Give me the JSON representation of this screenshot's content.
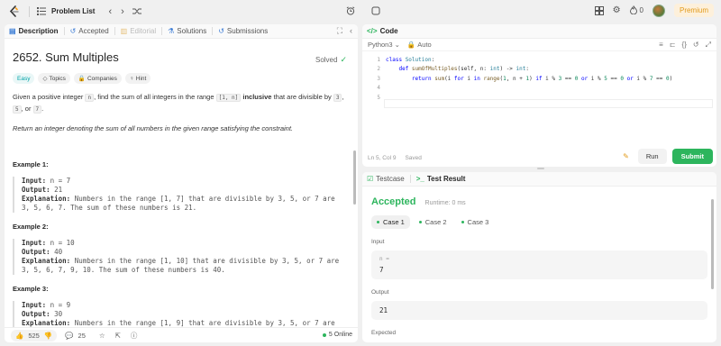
{
  "topbar": {
    "title": "Problem List",
    "streak_count": "0",
    "premium_label": "Premium"
  },
  "left_tabs": [
    {
      "label": "Description",
      "icon": "document-icon",
      "state": "active"
    },
    {
      "label": "Accepted",
      "icon": "history-icon",
      "state": "normal"
    },
    {
      "label": "Editorial",
      "icon": "book-icon",
      "state": "disabled"
    },
    {
      "label": "Solutions",
      "icon": "flask-icon",
      "state": "normal"
    },
    {
      "label": "Submissions",
      "icon": "history-icon",
      "state": "normal"
    }
  ],
  "problem": {
    "title": "2652. Sum Multiples",
    "status": "Solved",
    "tags": [
      "Easy",
      "Topics",
      "Companies",
      "Hint"
    ],
    "desc_1a": "Given a positive integer ",
    "desc_1_n": "n",
    "desc_1b": ", find the sum of all integers in the range ",
    "desc_1_range": "[1, n]",
    "desc_1_bold": "inclusive",
    "desc_1c": " that are divisible by ",
    "desc_1_3": "3",
    "desc_1d": ", ",
    "desc_1_5": "5",
    "desc_1e": ", or ",
    "desc_1_7": "7",
    "desc_1f": ".",
    "desc_2": "Return an integer denoting the sum of all numbers in the given range satisfying the constraint."
  },
  "examples": [
    {
      "title": "Example 1:",
      "input_label": "Input:",
      "input_value": " n = 7",
      "output_label": "Output:",
      "output_value": " 21",
      "explanation_label": "Explanation:",
      "explanation": " Numbers in the range [1, 7] that are divisible by 3, 5, or 7 are 3, 5, 6, 7. The sum of these numbers is 21."
    },
    {
      "title": "Example 2:",
      "input_label": "Input:",
      "input_value": " n = 10",
      "output_label": "Output:",
      "output_value": " 40",
      "explanation_label": "Explanation:",
      "explanation": " Numbers in the range [1, 10] that are divisible by 3, 5, or 7 are 3, 5, 6, 7, 9, 10. The sum of these numbers is 40."
    },
    {
      "title": "Example 3:",
      "input_label": "Input:",
      "input_value": " n = 9",
      "output_label": "Output:",
      "output_value": " 30",
      "explanation_label": "Explanation:",
      "explanation": " Numbers in the range [1, 9] that are divisible by 3, 5, or 7 are"
    }
  ],
  "footer": {
    "likes": "525",
    "comments": "25",
    "online": "5 Online"
  },
  "code_panel": {
    "tab_label": "Code",
    "language": "Python3",
    "mode": "Auto",
    "line_numbers": [
      "1",
      "2",
      "3",
      "4",
      "5"
    ],
    "cursor_pos": "Ln 5, Col 9",
    "saved": "Saved",
    "run_label": "Run",
    "submit_label": "Submit"
  },
  "result_panel": {
    "tabs": [
      "Testcase",
      "Test Result"
    ],
    "verdict": "Accepted",
    "runtime": "Runtime: 0 ms",
    "cases": [
      "Case 1",
      "Case 2",
      "Case 3"
    ],
    "input_label": "Input",
    "input_var": "n =",
    "input_value": "7",
    "output_label": "Output",
    "output_value": "21",
    "expected_label": "Expected"
  }
}
